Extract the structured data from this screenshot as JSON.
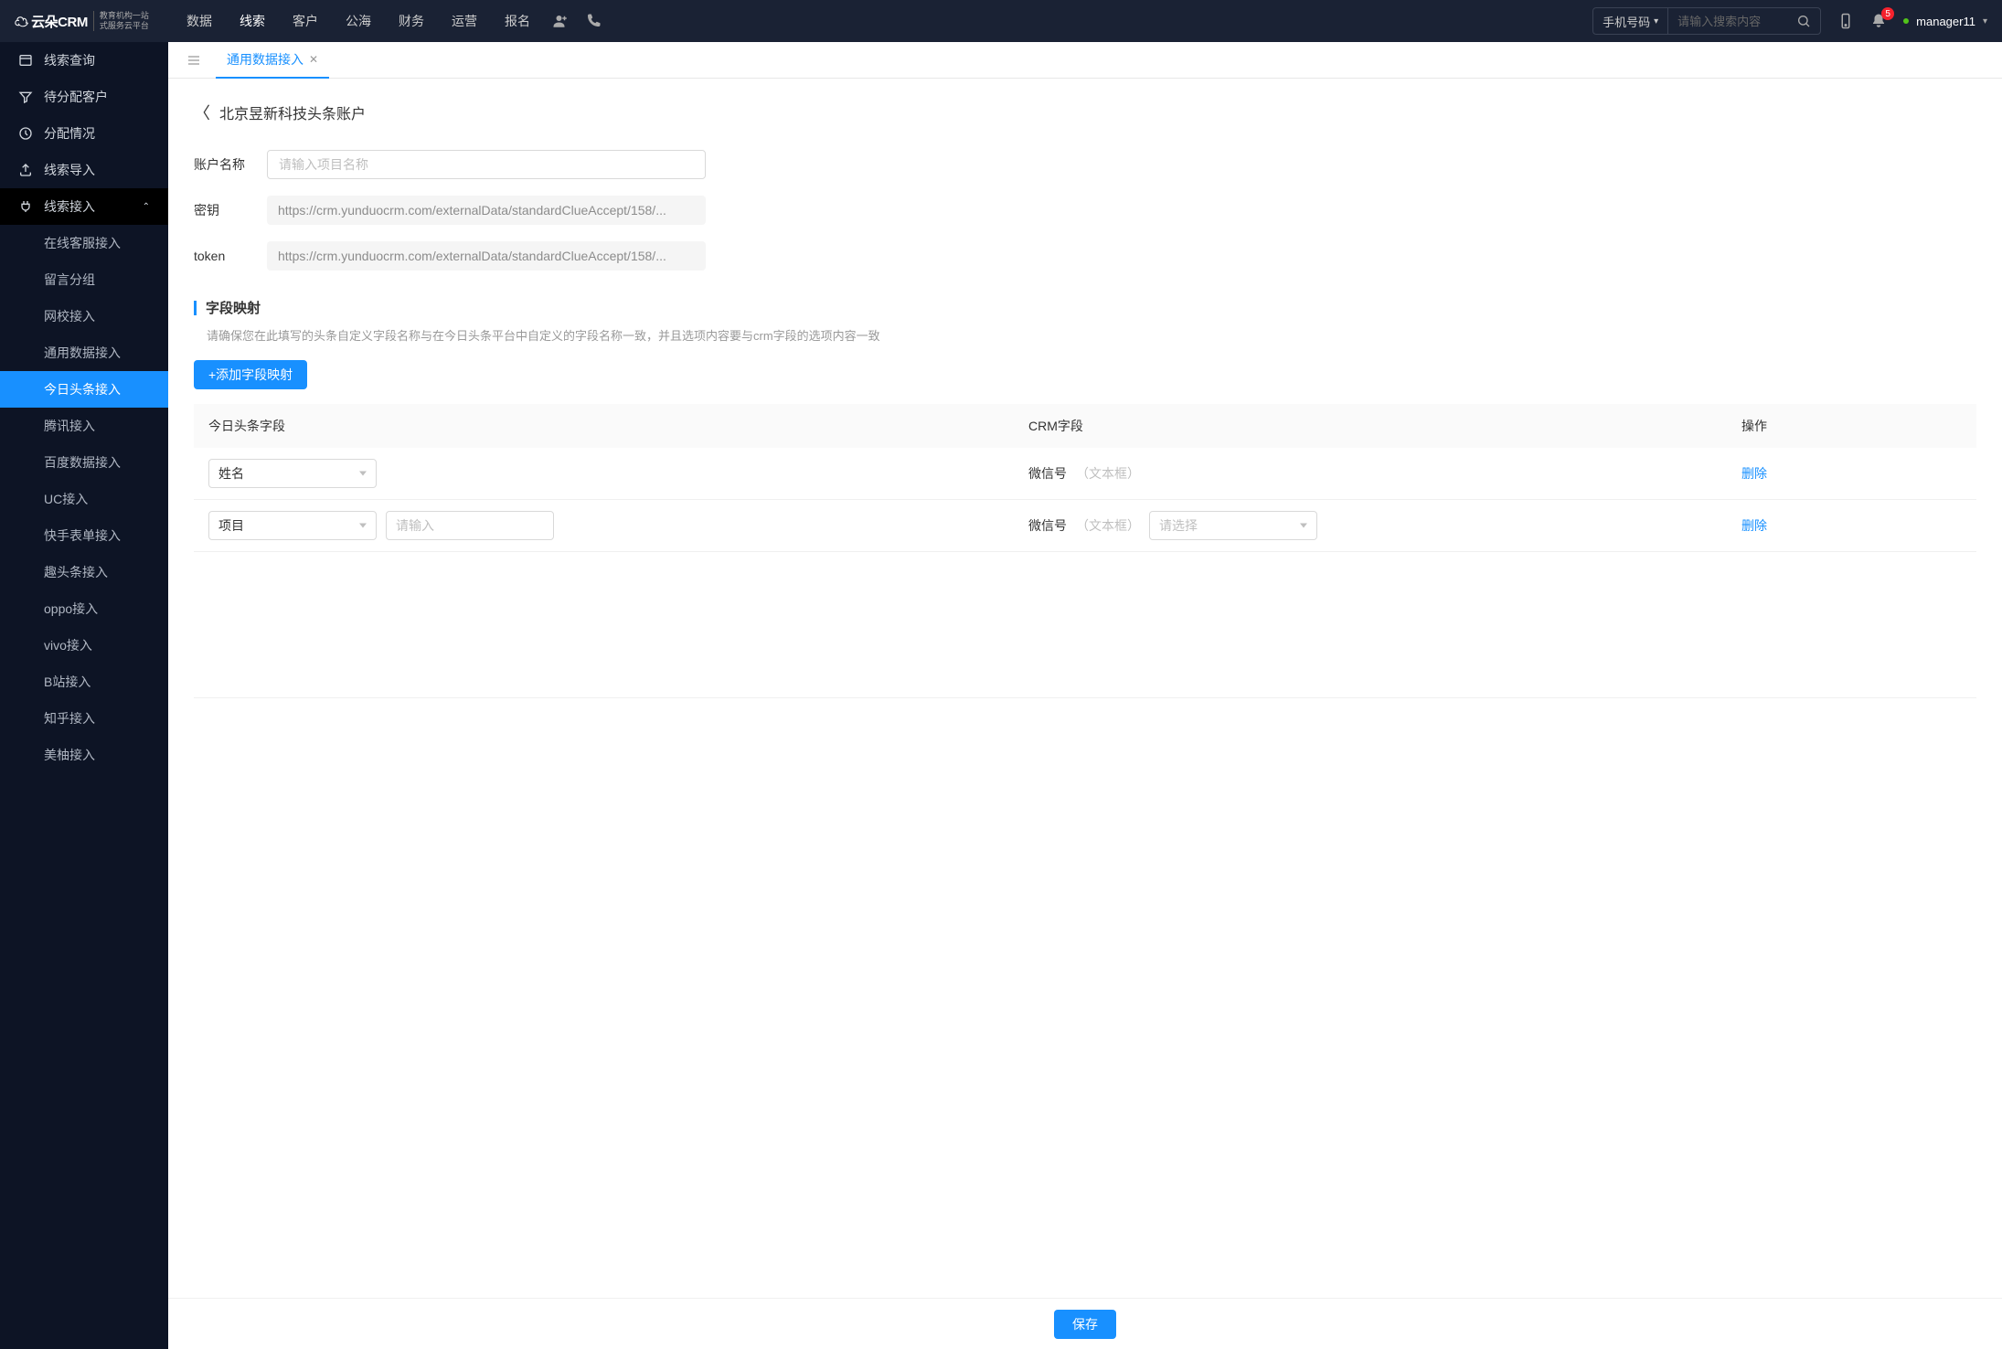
{
  "logo": {
    "brand": "☁ 云朵CRM",
    "sub1": "教育机构一站",
    "sub2": "式服务云平台"
  },
  "topNav": [
    "数据",
    "线索",
    "客户",
    "公海",
    "财务",
    "运营",
    "报名"
  ],
  "topNavActive": 1,
  "search": {
    "type": "手机号码",
    "placeholder": "请输入搜索内容"
  },
  "notif": {
    "count": "5"
  },
  "user": {
    "name": "manager11"
  },
  "sidebar": {
    "items": [
      {
        "icon": "list",
        "label": "线索查询"
      },
      {
        "icon": "filter",
        "label": "待分配客户"
      },
      {
        "icon": "clock",
        "label": "分配情况"
      },
      {
        "icon": "upload",
        "label": "线索导入"
      },
      {
        "icon": "plug",
        "label": "线索接入",
        "expanded": true
      }
    ],
    "subs": [
      "在线客服接入",
      "留言分组",
      "网校接入",
      "通用数据接入",
      "今日头条接入",
      "腾讯接入",
      "百度数据接入",
      "UC接入",
      "快手表单接入",
      "趣头条接入",
      "oppo接入",
      "vivo接入",
      "B站接入",
      "知乎接入",
      "美柚接入"
    ],
    "subActive": 4
  },
  "tabs": {
    "active": {
      "label": "通用数据接入"
    }
  },
  "page": {
    "title": "北京昱新科技头条账户",
    "form": {
      "nameLabel": "账户名称",
      "namePlaceholder": "请输入项目名称",
      "keyLabel": "密钥",
      "keyValue": "https://crm.yunduocrm.com/externalData/standardClueAccept/158/...",
      "tokenLabel": "token",
      "tokenValue": "https://crm.yunduocrm.com/externalData/standardClueAccept/158/..."
    },
    "section": {
      "title": "字段映射",
      "hint": "请确保您在此填写的头条自定义字段名称与在今日头条平台中自定义的字段名称一致，并且选项内容要与crm字段的选项内容一致",
      "addBtn": "+添加字段映射"
    },
    "table": {
      "cols": [
        "今日头条字段",
        "CRM字段",
        "操作"
      ],
      "rows": [
        {
          "field": "姓名",
          "crmName": "微信号",
          "crmType": "（文本框）",
          "delLabel": "删除",
          "extra": false
        },
        {
          "field": "项目",
          "extraPlaceholder": "请输入",
          "crmName": "微信号",
          "crmType": "（文本框）",
          "selectPlaceholder": "请选择",
          "delLabel": "删除",
          "extra": true
        }
      ]
    },
    "saveBtn": "保存"
  }
}
